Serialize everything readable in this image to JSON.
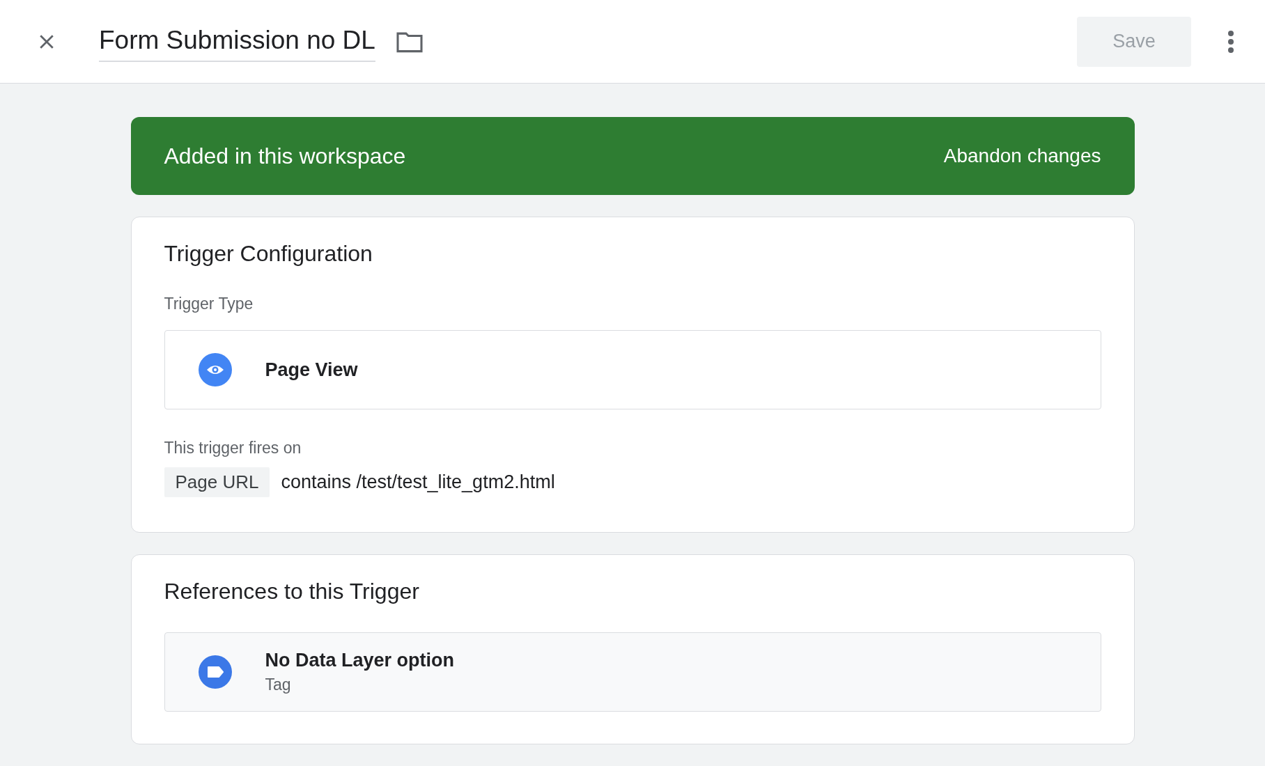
{
  "header": {
    "title": "Form Submission no DL",
    "save_button": {
      "label": "Save",
      "disabled": true
    }
  },
  "banner": {
    "message": "Added in this workspace",
    "action": "Abandon changes"
  },
  "trigger_configuration": {
    "title": "Trigger Configuration",
    "type_label": "Trigger Type",
    "type": {
      "name": "Page View"
    },
    "fires_on_label": "This trigger fires on",
    "conditions": [
      {
        "variable": "Page URL",
        "rule": "contains /test/test_lite_gtm2.html"
      }
    ]
  },
  "references": {
    "title": "References to this Trigger",
    "items": [
      {
        "name": "No Data Layer option",
        "kind": "Tag"
      }
    ]
  }
}
